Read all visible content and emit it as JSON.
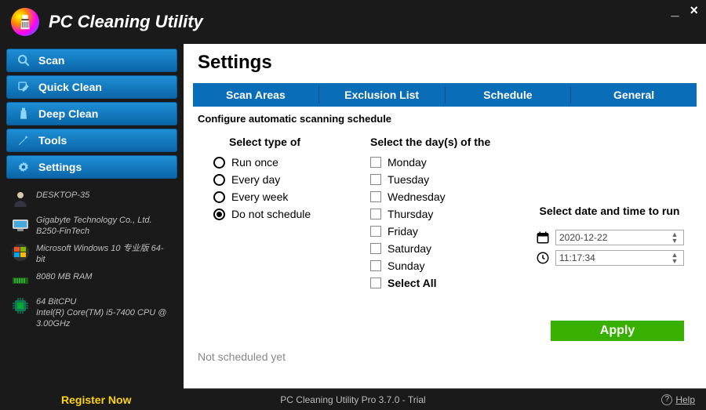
{
  "app": {
    "title": "PC Cleaning Utility",
    "footer_version": "PC Cleaning Utility Pro 3.7.0 - Trial",
    "register_label": "Register Now",
    "help_label": "Help"
  },
  "nav": [
    {
      "label": "Scan",
      "icon": "search-icon"
    },
    {
      "label": "Quick Clean",
      "icon": "quick-clean-icon"
    },
    {
      "label": "Deep Clean",
      "icon": "deep-clean-icon"
    },
    {
      "label": "Tools",
      "icon": "wrench-icon"
    },
    {
      "label": "Settings",
      "icon": "gear-icon"
    }
  ],
  "system": {
    "hostname": "DESKTOP-35",
    "motherboard": "Gigabyte Technology Co., Ltd. B250-FinTech",
    "os": "Microsoft Windows 10 专业版 64-bit",
    "ram": "8080 MB RAM",
    "cpu": "64 BitCPU\nIntel(R) Core(TM) i5-7400 CPU @ 3.00GHz"
  },
  "page": {
    "title": "Settings",
    "tabs": [
      "Scan Areas",
      "Exclusion List",
      "Schedule",
      "General"
    ],
    "active_tab": 2,
    "section_heading": "Configure automatic scanning schedule",
    "col_schedule_heading": "Select type of",
    "col_days_heading": "Select the day(s) of the",
    "col_datetime_heading": "Select date and time to run",
    "schedule_options": [
      "Run once",
      "Every day",
      "Every week",
      "Do not schedule"
    ],
    "schedule_selected": 3,
    "days": [
      "Monday",
      "Tuesday",
      "Wednesday",
      "Thursday",
      "Friday",
      "Saturday",
      "Sunday"
    ],
    "select_all_label": "Select All",
    "date_value": "2020-12-22",
    "time_value": "11:17:34",
    "apply_label": "Apply",
    "status": "Not scheduled yet"
  }
}
